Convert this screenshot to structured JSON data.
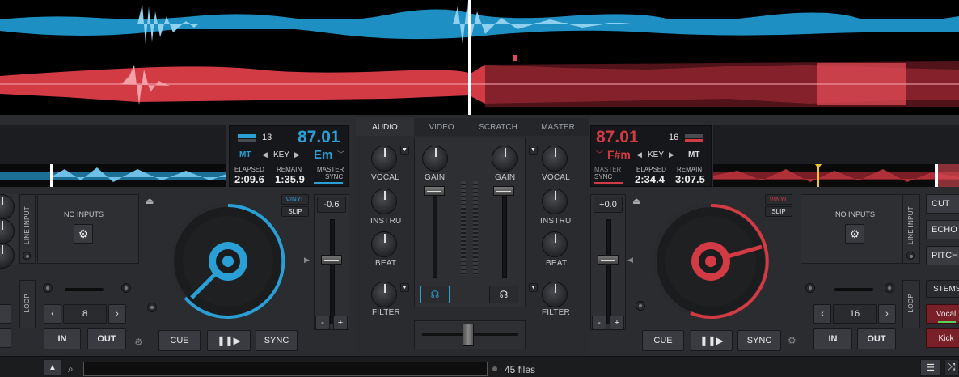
{
  "mixer": {
    "tabs": [
      {
        "label": "AUDIO"
      },
      {
        "label": "VIDEO"
      },
      {
        "label": "SCRATCH"
      },
      {
        "label": "MASTER"
      }
    ],
    "left_knobs": [
      "VOCAL",
      "INSTRU",
      "BEAT",
      "FILTER"
    ],
    "right_knobs": [
      "VOCAL",
      "INSTRU",
      "BEAT",
      "FILTER"
    ],
    "gain_left": "GAIN",
    "gain_right": "GAIN"
  },
  "deck1": {
    "bpm": "87.01",
    "index": "13",
    "mt": "MT",
    "key_label": "KEY",
    "key_value": "Em",
    "elapsed_label": "ELAPSED",
    "elapsed": "2:09.6",
    "remain_label": "REMAIN",
    "remain": "1:35.9",
    "master_label": "MASTER",
    "sync_label": "SYNC",
    "no_inputs": "NO INPUTS",
    "line_input": "LINE INPUT",
    "loop": "LOOP",
    "vinyl": "VINYL",
    "slip": "SLIP",
    "pitch": "-0.6",
    "loop_value": "8",
    "in": "IN",
    "out": "OUT",
    "cue": "CUE",
    "sync": "SYNC",
    "color": "#2a9fd6"
  },
  "deck2": {
    "bpm": "87.01",
    "index": "16",
    "mt": "MT",
    "key_label": "KEY",
    "key_value": "F#m",
    "elapsed_label": "ELAPSED",
    "elapsed": "2:34.4",
    "remain_label": "REMAIN",
    "remain": "3:07.5",
    "master_label": "MASTER",
    "sync_label": "SYNC",
    "no_inputs": "NO INPUTS",
    "line_input": "LINE INPUT",
    "loop": "LOOP",
    "vinyl": "VINYL",
    "slip": "SLIP",
    "pitch": "+0.0",
    "loop_value": "16",
    "in": "IN",
    "out": "OUT",
    "cue": "CUE",
    "sync": "SYNC",
    "color": "#d23a44"
  },
  "effects": {
    "buttons": [
      "CUT",
      "ECHO",
      "PITCH"
    ],
    "stems": "STEMS",
    "stem_buttons": [
      "Vocal",
      "Kick"
    ]
  },
  "browser": {
    "files": "45 files",
    "search_placeholder": ""
  }
}
